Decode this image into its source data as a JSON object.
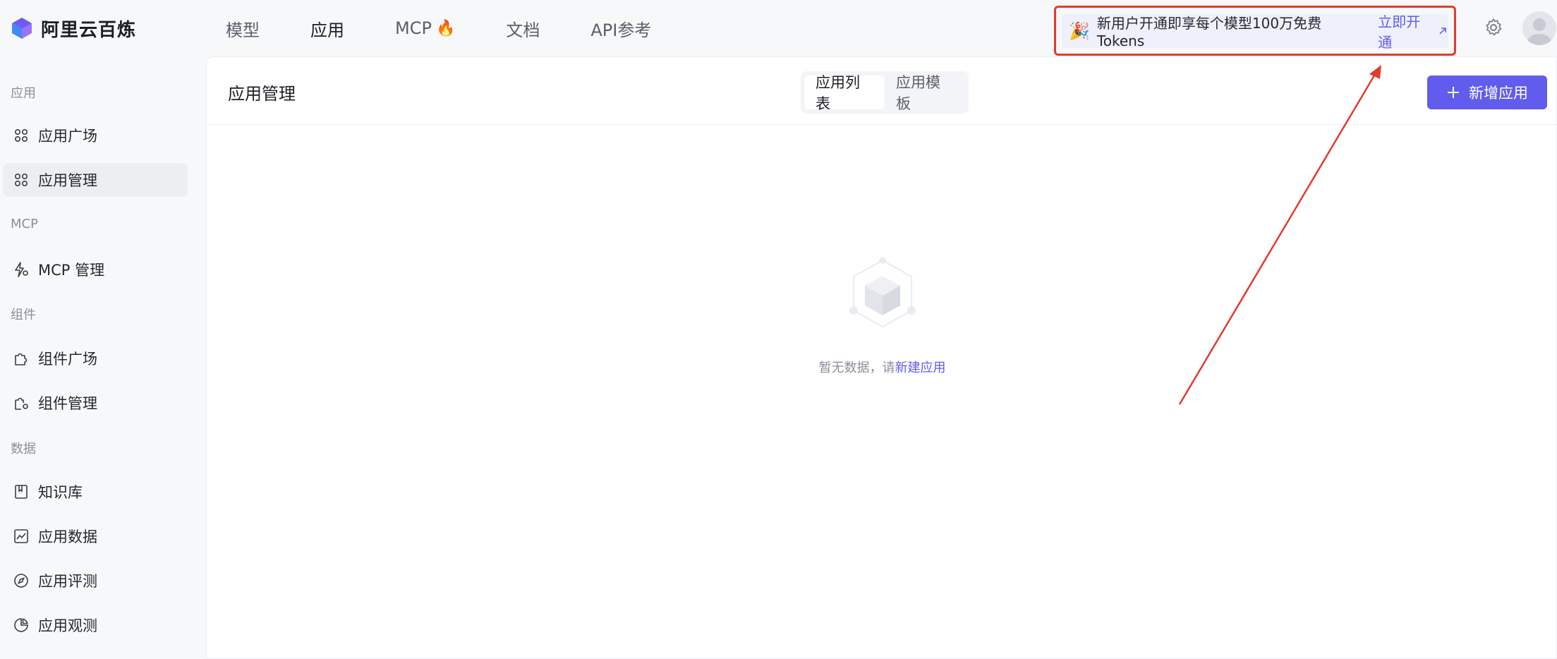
{
  "brand": {
    "name": "阿里云百炼"
  },
  "nav": {
    "items": [
      {
        "label": "模型"
      },
      {
        "label": "应用"
      },
      {
        "label": "MCP"
      },
      {
        "label": "文档"
      },
      {
        "label": "API参考"
      }
    ]
  },
  "promo": {
    "text": "新用户开通即享每个模型100万免费Tokens",
    "link": "立即开通"
  },
  "sidebar": {
    "groups": [
      {
        "title": "应用",
        "items": [
          "应用广场",
          "应用管理"
        ]
      },
      {
        "title": "MCP",
        "items": [
          "MCP 管理"
        ]
      },
      {
        "title": "组件",
        "items": [
          "组件广场",
          "组件管理"
        ]
      },
      {
        "title": "数据",
        "items": [
          "知识库",
          "应用数据",
          "应用评测",
          "应用观测"
        ]
      }
    ]
  },
  "main": {
    "title": "应用管理",
    "tabs": [
      {
        "label": "应用列表"
      },
      {
        "label": "应用模板"
      }
    ],
    "add_button": "新增应用",
    "empty": {
      "text": "暂无数据，请",
      "link": "新建应用"
    }
  },
  "colors": {
    "accent": "#615ced",
    "annotation": "#e23b2e"
  }
}
